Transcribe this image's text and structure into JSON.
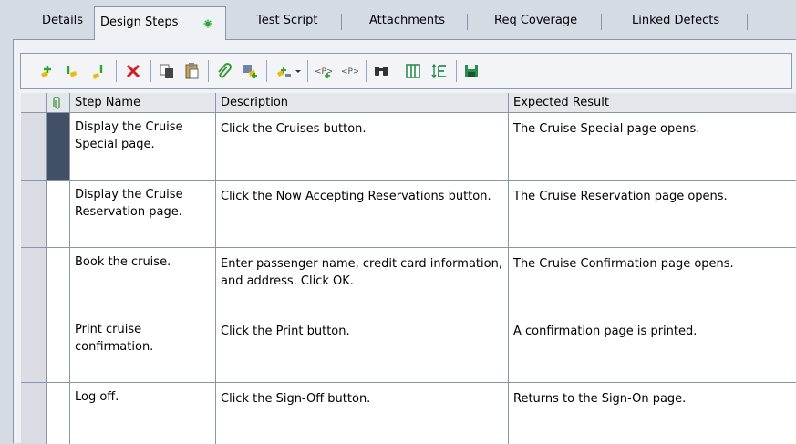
{
  "tabs": [
    {
      "label": "Details"
    },
    {
      "label": "Design Steps",
      "active": true,
      "modified_icon": "green-star-icon"
    },
    {
      "label": "Test Script"
    },
    {
      "label": "Attachments"
    },
    {
      "label": "Req Coverage"
    },
    {
      "label": "Linked Defects"
    }
  ],
  "toolbar": {
    "buttons": [
      "new-step-icon",
      "insert-before-icon",
      "insert-after-icon",
      "delete-icon",
      "copy-icon",
      "paste-icon",
      "attachment-icon",
      "call-test-icon",
      "generate-script-dropdown-icon",
      "insert-parameter-icon",
      "parameters-icon",
      "find-icon",
      "select-columns-icon",
      "adjust-height-icon",
      "save-icon"
    ]
  },
  "grid": {
    "columns": {
      "attachment_icon": "paperclip-icon",
      "step_name": "Step Name",
      "description": "Description",
      "expected": "Expected Result"
    },
    "rows": [
      {
        "step_name": "Display the Cruise Special page.",
        "description": "Click the Cruises button.",
        "expected": "The Cruise Special page opens.",
        "selected": true
      },
      {
        "step_name": "Display the Cruise Reservation page.",
        "description": "Click the Now Accepting Reservations button.",
        "expected": "The Cruise Reservation page opens."
      },
      {
        "step_name": "Book the cruise.",
        "description": "Enter passenger name, credit card information, and address. Click OK.",
        "expected": "The Cruise Confirmation page opens."
      },
      {
        "step_name": "Print cruise confirmation.",
        "description": "Click the Print button.",
        "expected": "A confirmation page is printed."
      },
      {
        "step_name": "Log off.",
        "description": "Click the Sign-Off button.",
        "expected": "Returns to the Sign-On page."
      }
    ]
  },
  "colors": {
    "selected_row_marker": "#415066",
    "accent_green": "#2aa82a",
    "delete_red": "#d21e1e"
  }
}
